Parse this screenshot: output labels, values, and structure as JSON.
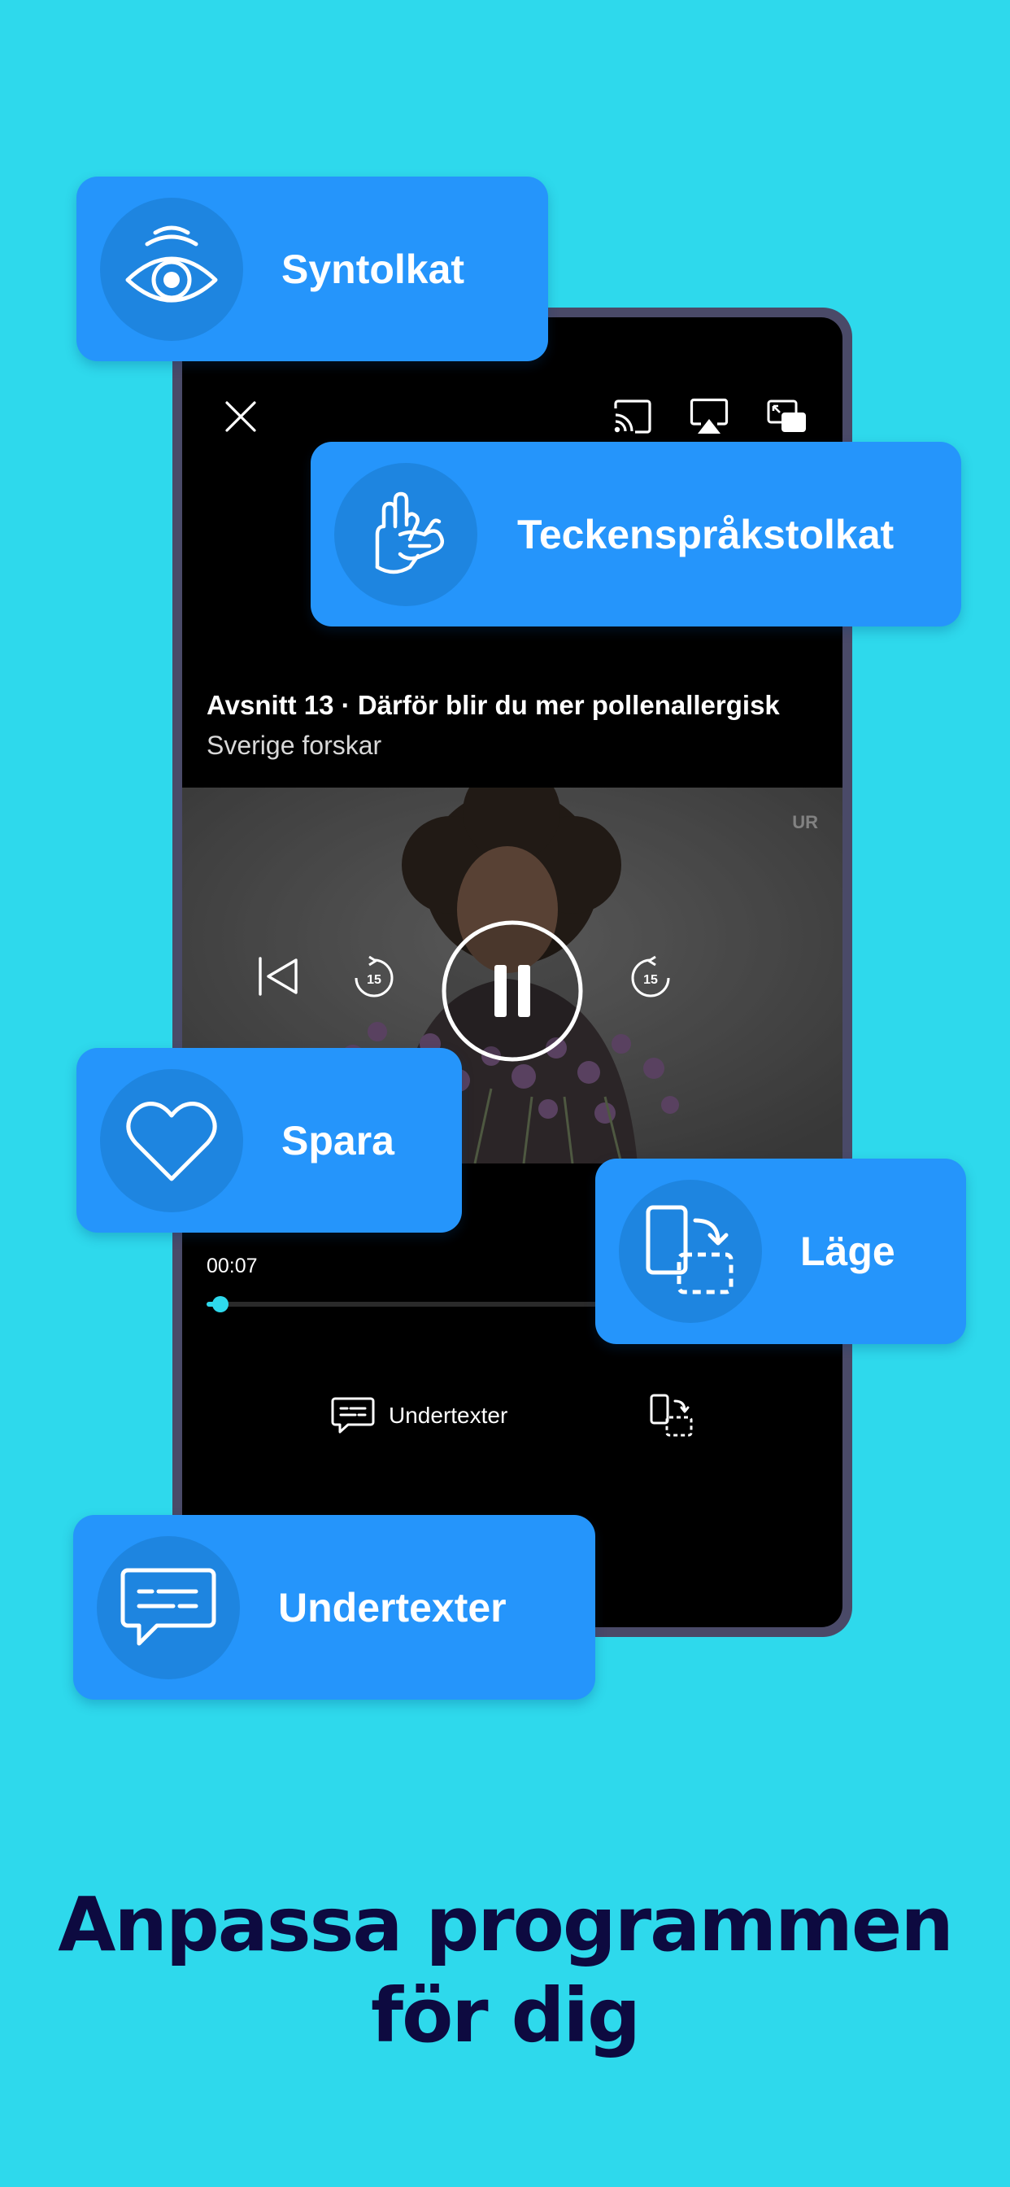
{
  "colors": {
    "background": "#2ed9ec",
    "card": "#2595fb",
    "card_icon_circle": "#1e85e0",
    "headline": "#0d0a40",
    "accent_progress": "#2ed9ec"
  },
  "player": {
    "close_icon": "close-icon",
    "cast_icon": "cast-icon",
    "airplay_icon": "airplay-icon",
    "pip_icon": "picture-in-picture-icon",
    "episode_title": "Avsnitt 13 · Därför blir du mer pollenallergisk",
    "program_name": "Sverige forskar",
    "watermark": "UR",
    "controls": {
      "previous_icon": "skip-previous-icon",
      "rewind_icon": "rewind-15-icon",
      "rewind_seconds": "15",
      "play_pause_icon": "pause-icon",
      "forward_icon": "forward-15-icon",
      "forward_seconds": "15"
    },
    "elapsed_time": "00:07",
    "progress_fraction": 0.03,
    "subtitles_label": "Undertexter",
    "mode_icon": "rotate-mode-icon"
  },
  "cards": {
    "syntolkat": {
      "label": "Syntolkat",
      "icon": "eye-icon"
    },
    "teckensprak": {
      "label": "Teckenspråkstolkat",
      "icon": "sign-language-hands-icon"
    },
    "spara": {
      "label": "Spara",
      "icon": "heart-icon"
    },
    "lage": {
      "label": "Läge",
      "icon": "rotate-mode-icon"
    },
    "undertexter": {
      "label": "Undertexter",
      "icon": "subtitles-icon"
    }
  },
  "headline": {
    "line1": "Anpassa programmen",
    "line2": "för dig"
  }
}
